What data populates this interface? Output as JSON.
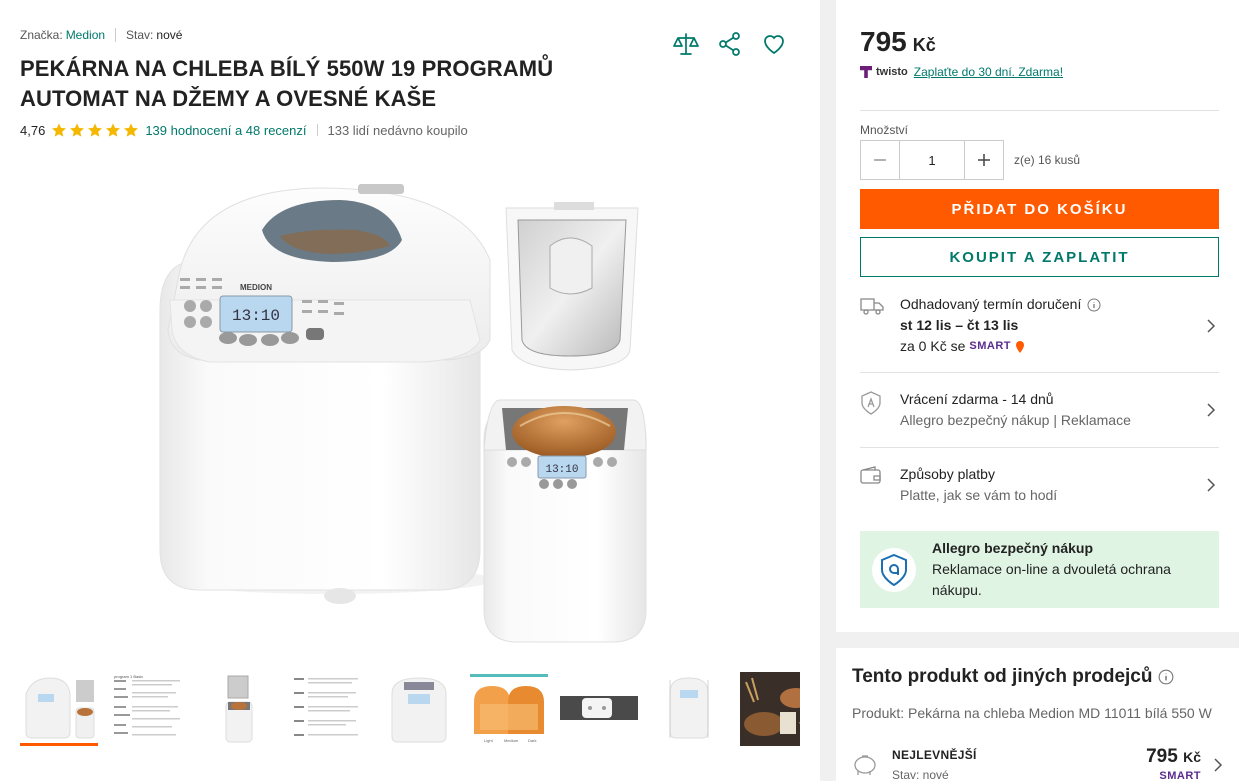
{
  "product": {
    "brand_label": "Značka:",
    "brand": "Medion",
    "condition_label": "Stav:",
    "condition": "nové",
    "title": "PEKÁRNA NA CHLEBA BÍLÝ 550W 19 PROGRAMŮ AUTOMAT NA DŽEMY A OVESNÉ KAŠE",
    "rating": "4,76",
    "stars": 5,
    "reviews_link": "139 hodnocení a 48 recenzí",
    "bought": "133 lidí nedávno koupilo"
  },
  "icons": {
    "compare": "compare-icon",
    "share": "share-icon",
    "favorite": "heart-icon"
  },
  "thumbnails": [
    {
      "name": "thumb-1",
      "active": true
    },
    {
      "name": "thumb-2",
      "active": false
    },
    {
      "name": "thumb-3",
      "active": false
    },
    {
      "name": "thumb-4",
      "active": false
    },
    {
      "name": "thumb-5",
      "active": false
    },
    {
      "name": "thumb-6",
      "active": false
    },
    {
      "name": "thumb-7",
      "active": false
    },
    {
      "name": "thumb-8",
      "active": false
    },
    {
      "name": "thumb-9",
      "active": false
    }
  ],
  "thumbnail_text": {
    "manual_1": "program 1 Basic",
    "loaf_labels": [
      "Light",
      "Medium",
      "Dark"
    ]
  },
  "display": {
    "time": "13:10",
    "brand": "MEDION"
  },
  "buy": {
    "price": "795",
    "currency": "Kč",
    "twisto_brand": "twisto",
    "twisto_link": "Zaplaťte do 30 dní. Zdarma!",
    "qty_label": "Množství",
    "qty_value": "1",
    "qty_of": "z(e) 16 kusů",
    "add_to_cart": "PŘIDAT DO KOŠÍKU",
    "buy_now": "KOUPIT A ZAPLATIT"
  },
  "delivery": {
    "title": "Odhadovaný termín doručení",
    "dates": "st 12 lis – čt 13 lis",
    "price_prefix": "za 0 Kč se",
    "smart": "SMART"
  },
  "returns": {
    "title": "Vrácení zdarma - 14 dnů",
    "sub": "Allegro bezpečný nákup | Reklamace"
  },
  "payment": {
    "title": "Způsoby platby",
    "sub": "Platte, jak se vám to hodí"
  },
  "safe": {
    "title": "Allegro bezpečný nákup",
    "text": "Reklamace on-line a dvouletá ochrana nákupu."
  },
  "other_sellers": {
    "title": "Tento produkt od jiných prodejců",
    "subtitle": "Produkt: Pekárna na chleba Medion MD 11011 bílá 550 W",
    "cheapest_label": "NEJLEVNĚJŠÍ",
    "cheapest_condition": "Stav: nové",
    "cheapest_price": "795",
    "cheapest_currency": "Kč",
    "smart": "SMART"
  },
  "colors": {
    "accent": "#ff5a00",
    "teal": "#00796b",
    "star": "#f5b800",
    "smart": "#5b2b8e"
  }
}
